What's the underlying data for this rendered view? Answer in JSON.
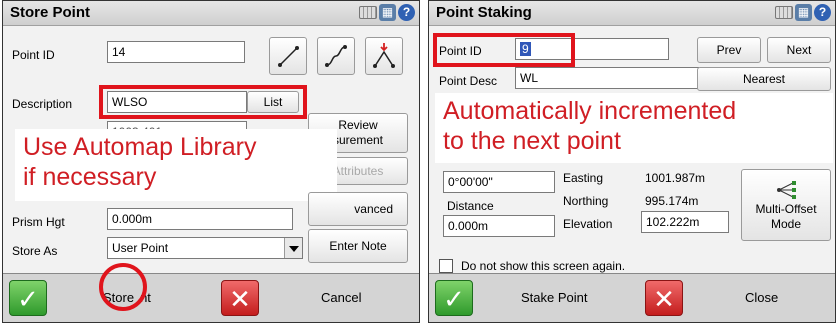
{
  "store_point": {
    "title": "Store Point",
    "point_id_label": "Point ID",
    "point_id_value": "14",
    "description_label": "Description",
    "description_value": "WLSO",
    "list_button": "List",
    "review_button_line1": "Review",
    "review_button_line2": "surement",
    "review_field_partial": "1003.401",
    "attributes_button": "Attributes",
    "prism_label": "Prism Hgt",
    "prism_value": "0.000m",
    "advanced_button": "vanced",
    "store_as_label": "Store As",
    "store_as_value": "User Point",
    "enter_note_button": "Enter Note",
    "store_label_a": "Store",
    "store_label_b": "nt",
    "cancel_label": "Cancel",
    "callout_line1": "Use Automap Library",
    "callout_line2": "if necessary"
  },
  "point_staking": {
    "title": "Point Staking",
    "point_id_label": "Point ID",
    "point_id_value": "9",
    "point_desc_label": "Point Desc",
    "point_desc_value": "WL",
    "prev_button": "Prev",
    "next_button": "Next",
    "nearest_button": "Nearest",
    "callout_line1": "Automatically incremented",
    "callout_line2": "to the next point",
    "angle_value": "0°00'00\"",
    "distance_label": "Distance",
    "distance_value": "0.000m",
    "easting_label": "Easting",
    "easting_value": "1001.987m",
    "northing_label": "Northing",
    "northing_value": "995.174m",
    "elevation_label": "Elevation",
    "elevation_value": "102.222m",
    "multi_offset_line1": "Multi-Offset",
    "multi_offset_line2": "Mode",
    "checkbox_label": "Do not show this screen again.",
    "stake_label": "Stake Point",
    "close_label": "Close"
  },
  "colors": {
    "annotation_red": "#e0141c",
    "callout_text": "#d01e24",
    "ok_green": "#2f9a2c",
    "cancel_red": "#c41d1d"
  },
  "icons": [
    "keyboard-icon",
    "grid-icon",
    "help-icon",
    "line-icon",
    "curve-icon",
    "triangle-icon",
    "multi-offset-icon",
    "check-icon",
    "x-icon"
  ]
}
